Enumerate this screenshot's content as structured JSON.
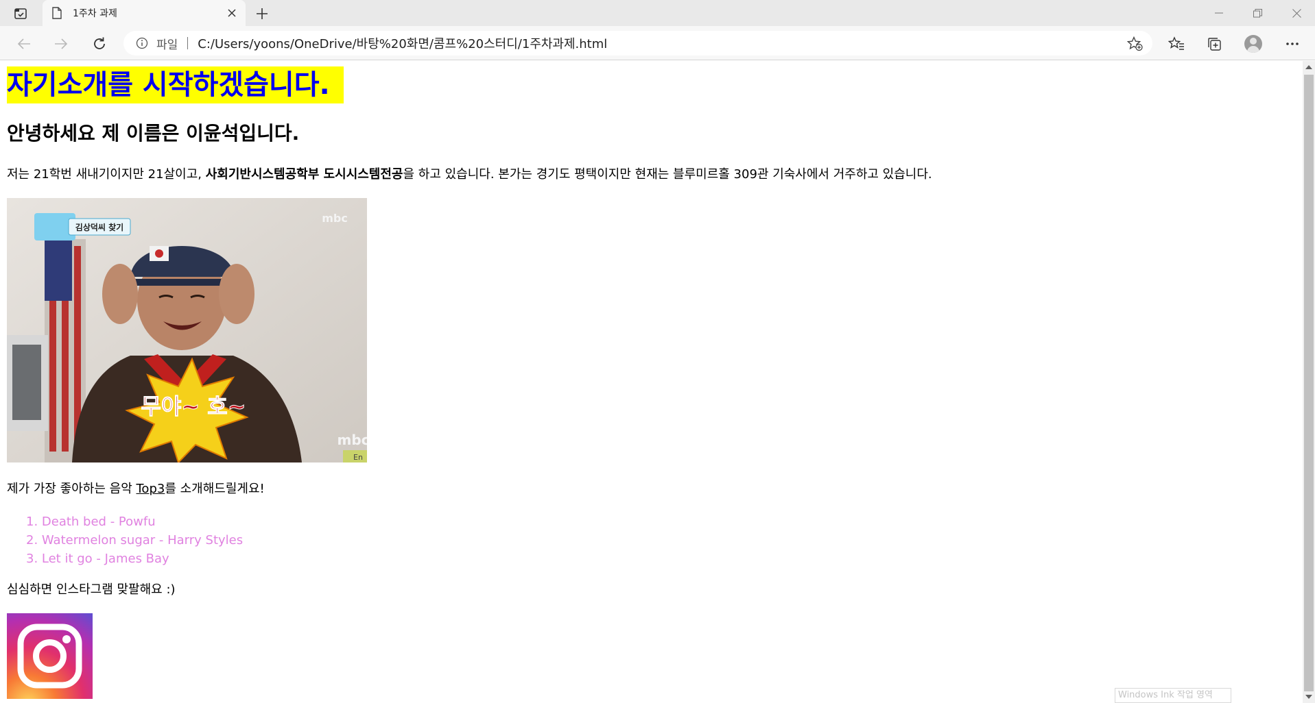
{
  "browser": {
    "tab": {
      "title": "1주차 과제"
    },
    "address": {
      "scheme_label": "파일",
      "url": "C:/Users/yoons/OneDrive/바탕%20화면/콤프%20스터디/1주차과제.html"
    }
  },
  "page": {
    "heading": "자기소개를 시작하겠습니다.",
    "subheading": "안녕하세요 제 이름은 이윤석입니다.",
    "intro": {
      "before": "저는 21학번 새내기이지만 21살이고, ",
      "bold": "사회기반시스템공학부 도시시스템전공",
      "after": "을 하고 있습니다. 본가는 경기도 평택이지만 현재는 블루미르홀 309관 기숙사에서 거주하고 있습니다."
    },
    "photo": {
      "caption_tag": "김상덕씨 찾기",
      "watermark": "mbc",
      "shout_text": "무야~ 호~",
      "corner_mark": "mbc",
      "corner_sub": "En"
    },
    "music_intro": {
      "before": "제가 가장 좋아하는 음악 ",
      "link": "Top3",
      "after": "를 소개해드릴게요!"
    },
    "music_list": [
      "1. Death bed - Powfu",
      "2. Watermelon sugar - Harry Styles",
      "3. Let it go - James Bay"
    ],
    "insta_text": "심심하면 인스타그램 맞팔해요 :)"
  },
  "overlay": {
    "ink_label": "Windows Ink 작업 영역"
  },
  "colors": {
    "heading_bg": "#ffff00",
    "heading_text": "#0000ee",
    "list_text": "#e082e0"
  }
}
